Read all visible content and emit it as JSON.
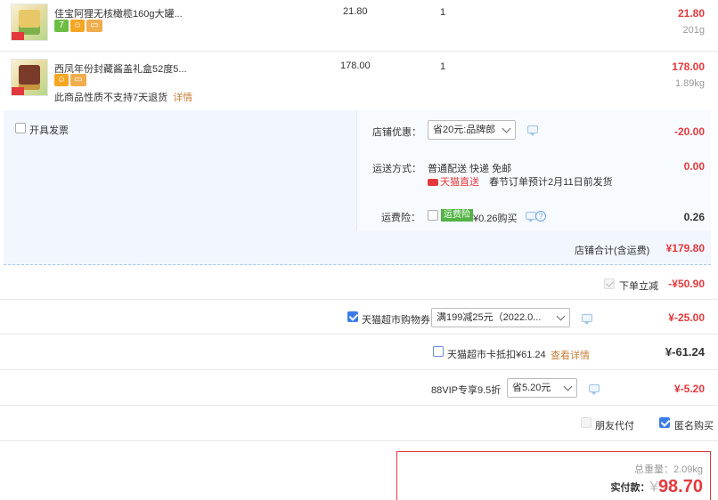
{
  "items": [
    {
      "name": "佳宝阿狸无核橄榄160g大罐...",
      "price": "21.80",
      "qty": "1",
      "subtotal": "21.80",
      "weight": "201g",
      "badges": [
        "7",
        "shield",
        "card"
      ]
    },
    {
      "name": "西凤年份封藏酱盖礼盒52度5...",
      "price": "178.00",
      "qty": "1",
      "subtotal": "178.00",
      "weight": "1.89kg",
      "badges": [
        "shield",
        "card"
      ],
      "notice": "此商品性质不支持7天退货",
      "notice_link": "详情"
    }
  ],
  "shop": {
    "invoice_label": "开具发票",
    "discount_label": "店铺优惠：",
    "discount_select": "省20元:品牌郎",
    "discount_amount": "-20.00",
    "shipping_label": "运送方式：",
    "shipping_value": "普通配送 快递 免邮",
    "shipping_tmall": "天猫直送",
    "shipping_note": "春节订单预计2月11日前发货",
    "shipping_amount": "0.00",
    "insurance_label": "运费险：",
    "insurance_tag": "运费险",
    "insurance_value": "¥0.26购买",
    "insurance_amount": "0.26",
    "shop_total_label": "店铺合计(含运费)",
    "shop_total_value": "¥179.80"
  },
  "order": {
    "instant_discount_label": "下单立减",
    "instant_discount_value": "-¥50.90",
    "coupon_label": "天猫超市购物券",
    "coupon_select": "满199减25元（2022.0...",
    "coupon_value": "¥-25.00",
    "card_label": "天猫超市卡抵扣¥61.24",
    "card_link": "查看详情",
    "card_value": "¥-61.24",
    "vip_label": "88VIP专享9.5折",
    "vip_select": "省5.20元",
    "vip_value": "¥-5.20",
    "friend_pay_label": "朋友代付",
    "anonymous_label": "匿名购买",
    "total_weight": "总重量：2.09kg",
    "actual_pay_label": "实付款：",
    "currency": "¥",
    "actual_pay_value": "98.70"
  }
}
